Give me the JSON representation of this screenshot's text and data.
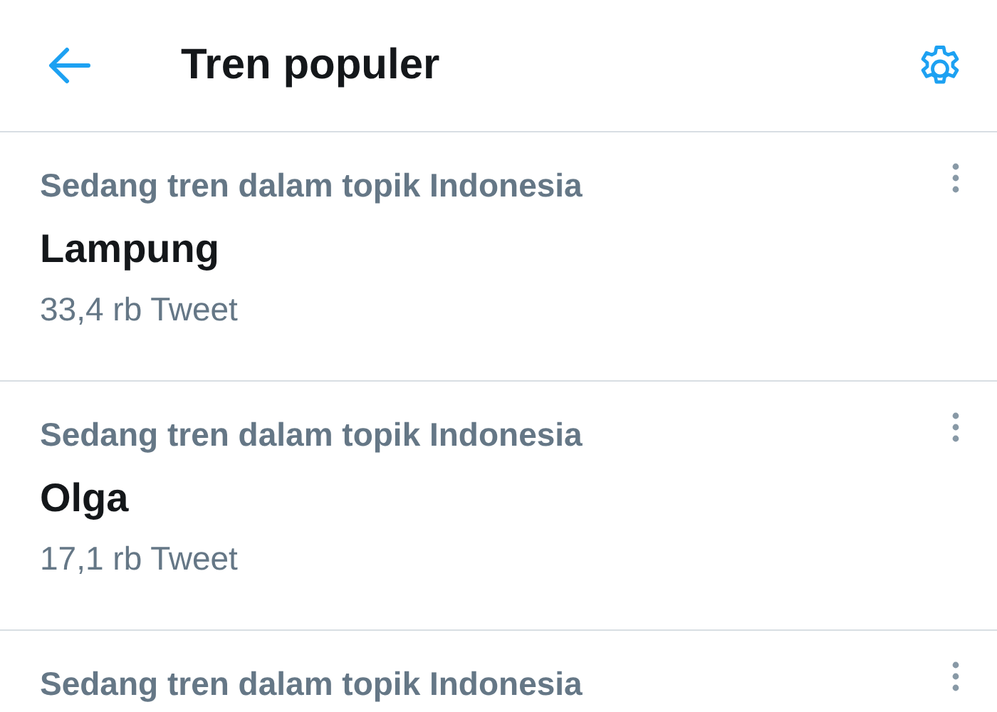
{
  "header": {
    "title": "Tren populer"
  },
  "trends": [
    {
      "context": "Sedang tren dalam topik Indonesia",
      "name": "Lampung",
      "count": "33,4 rb Tweet"
    },
    {
      "context": "Sedang tren dalam topik Indonesia",
      "name": "Olga",
      "count": "17,1 rb Tweet"
    },
    {
      "context": "Sedang tren dalam topik Indonesia"
    }
  ]
}
